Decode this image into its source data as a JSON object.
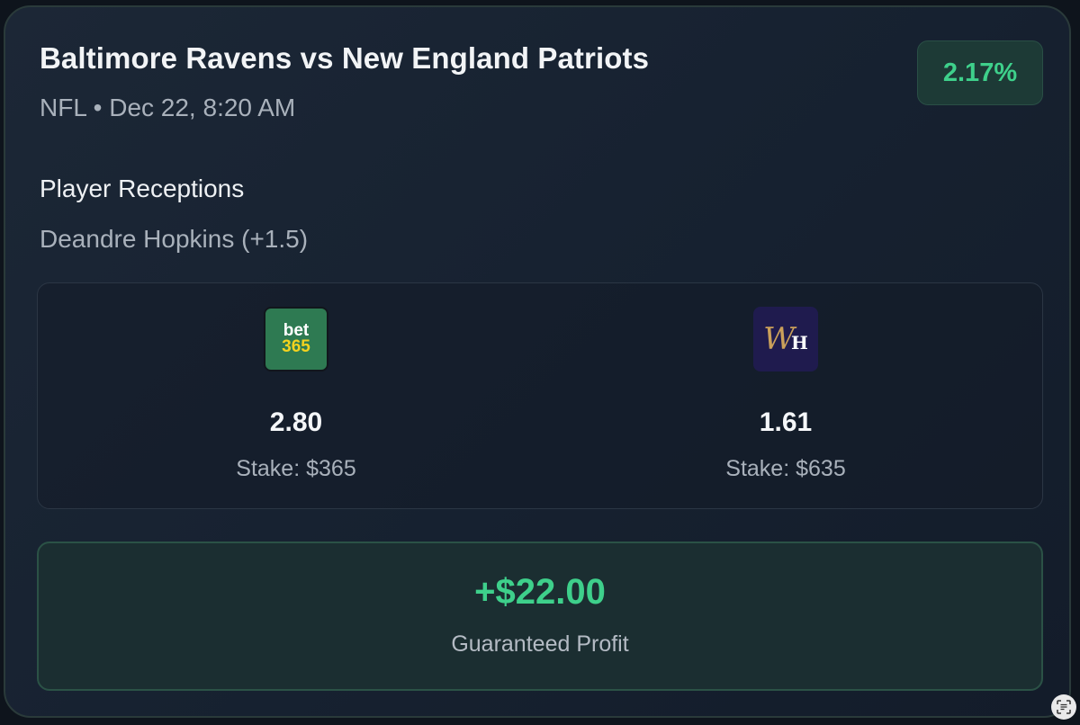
{
  "event": {
    "title": "Baltimore Ravens vs New England Patriots",
    "subtitle": "NFL • Dec 22, 8:20 AM"
  },
  "arb_percentage": "2.17%",
  "market": {
    "name": "Player Receptions",
    "selection": "Deandre Hopkins (+1.5)"
  },
  "books": [
    {
      "logo_line1": "bet",
      "logo_line2": "365",
      "logo_icon": "bet365-logo-icon",
      "odds": "2.80",
      "stake": "Stake: $365"
    },
    {
      "logo_line1": "W",
      "logo_line2": "H",
      "logo_icon": "william-hill-logo-icon",
      "odds": "1.61",
      "stake": "Stake: $635"
    }
  ],
  "profit": {
    "value": "+$22.00",
    "label": "Guaranteed Profit"
  },
  "colors": {
    "accent_green": "#3ed08b",
    "card_bg": "#172231",
    "profit_bg": "#1b2e31"
  }
}
